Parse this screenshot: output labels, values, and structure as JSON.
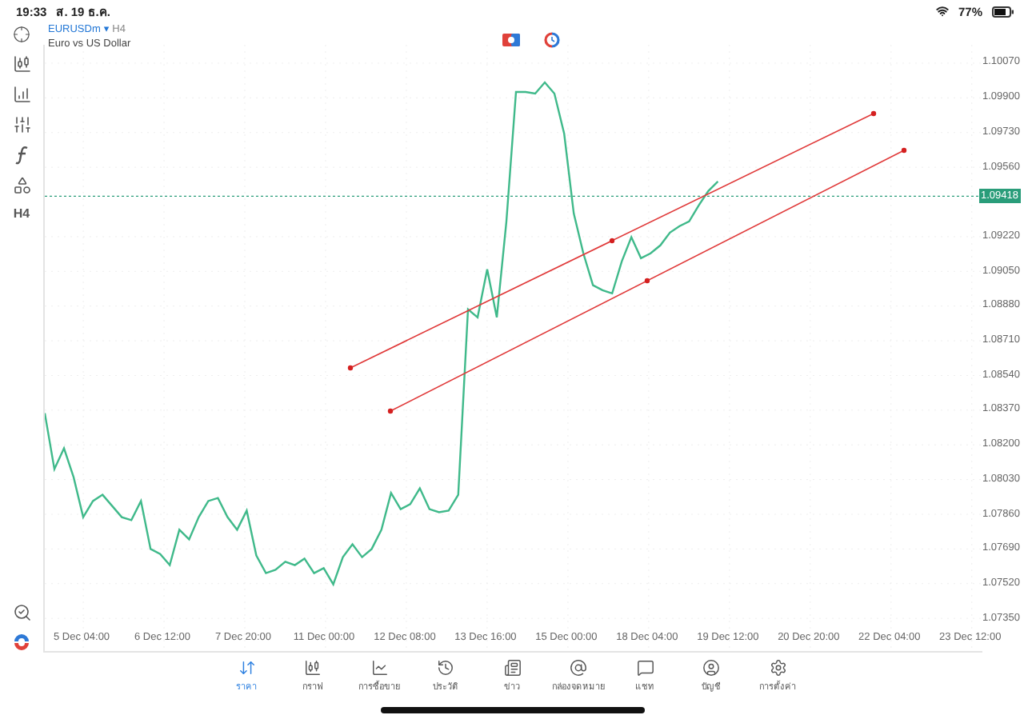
{
  "status_bar": {
    "time": "19:33",
    "date": "ส. 19 ธ.ค.",
    "battery": "77%"
  },
  "toolbar": {
    "timeframe": "H4"
  },
  "chart": {
    "symbol": "EURUSDm",
    "symbol_marker": "▾",
    "timeframe": "H4",
    "description": "Euro vs US Dollar",
    "time_axis": [
      "5 Dec 04:00",
      "6 Dec 12:00",
      "7 Dec 20:00",
      "11 Dec 00:00",
      "12 Dec 08:00",
      "13 Dec 16:00",
      "15 Dec 00:00",
      "18 Dec 04:00",
      "19 Dec 12:00",
      "20 Dec 20:00",
      "22 Dec 04:00",
      "23 Dec 12:00"
    ],
    "chart_data": {
      "type": "line",
      "grid": true,
      "ylim": [
        1.0719,
        1.1016
      ],
      "yticks": [
        {
          "value": 1.1007,
          "label": "1.10070"
        },
        {
          "value": 1.099,
          "label": "1.09900"
        },
        {
          "value": 1.0973,
          "label": "1.09730"
        },
        {
          "value": 1.0956,
          "label": "1.09560"
        },
        {
          "value": 1.0922,
          "label": "1.09220"
        },
        {
          "value": 1.0905,
          "label": "1.09050"
        },
        {
          "value": 1.0888,
          "label": "1.08880"
        },
        {
          "value": 1.0871,
          "label": "1.08710"
        },
        {
          "value": 1.0854,
          "label": "1.08540"
        },
        {
          "value": 1.0837,
          "label": "1.08370"
        },
        {
          "value": 1.082,
          "label": "1.08200"
        },
        {
          "value": 1.0803,
          "label": "1.08030"
        },
        {
          "value": 1.0786,
          "label": "1.07860"
        },
        {
          "value": 1.0769,
          "label": "1.07690"
        },
        {
          "value": 1.0752,
          "label": "1.07520"
        },
        {
          "value": 1.0735,
          "label": "1.07350"
        }
      ],
      "series": [
        {
          "color": "#3fb98a",
          "values": [
            1.08355,
            1.08081,
            1.08183,
            1.08042,
            1.07846,
            1.07925,
            1.07956,
            1.07901,
            1.07846,
            1.07831,
            1.07925,
            1.0769,
            1.07666,
            1.07611,
            1.07784,
            1.07737,
            1.07846,
            1.07925,
            1.0794,
            1.07846,
            1.07784,
            1.07878,
            1.07658,
            1.07572,
            1.07588,
            1.07627,
            1.07611,
            1.07643,
            1.07572,
            1.07596,
            1.07517,
            1.0765,
            1.07713,
            1.0765,
            1.0769,
            1.07784,
            1.07964,
            1.07885,
            1.07909,
            1.07987,
            1.07885,
            1.0787,
            1.07878,
            1.07956,
            1.08864,
            1.08825,
            1.0906,
            1.08825,
            1.09295,
            1.09929,
            1.09929,
            1.09921,
            1.09976,
            1.09921,
            1.09725,
            1.09334,
            1.09138,
            1.08982,
            1.08958,
            1.08942,
            1.09099,
            1.09217,
            1.09115,
            1.09138,
            1.09177,
            1.0924,
            1.09271,
            1.09295,
            1.09373,
            1.09444,
            1.09491
          ]
        }
      ],
      "ref_lines": [
        {
          "axis": "y",
          "value": 1.09418,
          "label": "1.09418"
        }
      ]
    }
  },
  "tabs": [
    {
      "label": "ราคา",
      "selected": true
    },
    {
      "label": "กราฟ",
      "selected": false
    },
    {
      "label": "การซื้อขาย",
      "selected": false
    },
    {
      "label": "ประวัติ",
      "selected": false
    },
    {
      "label": "ข่าว",
      "selected": false
    },
    {
      "label": "กล่องจดหมาย",
      "selected": false
    },
    {
      "label": "แชท",
      "selected": false
    },
    {
      "label": "บัญชี",
      "selected": false
    },
    {
      "label": "การตั้งค่า",
      "selected": false
    }
  ]
}
